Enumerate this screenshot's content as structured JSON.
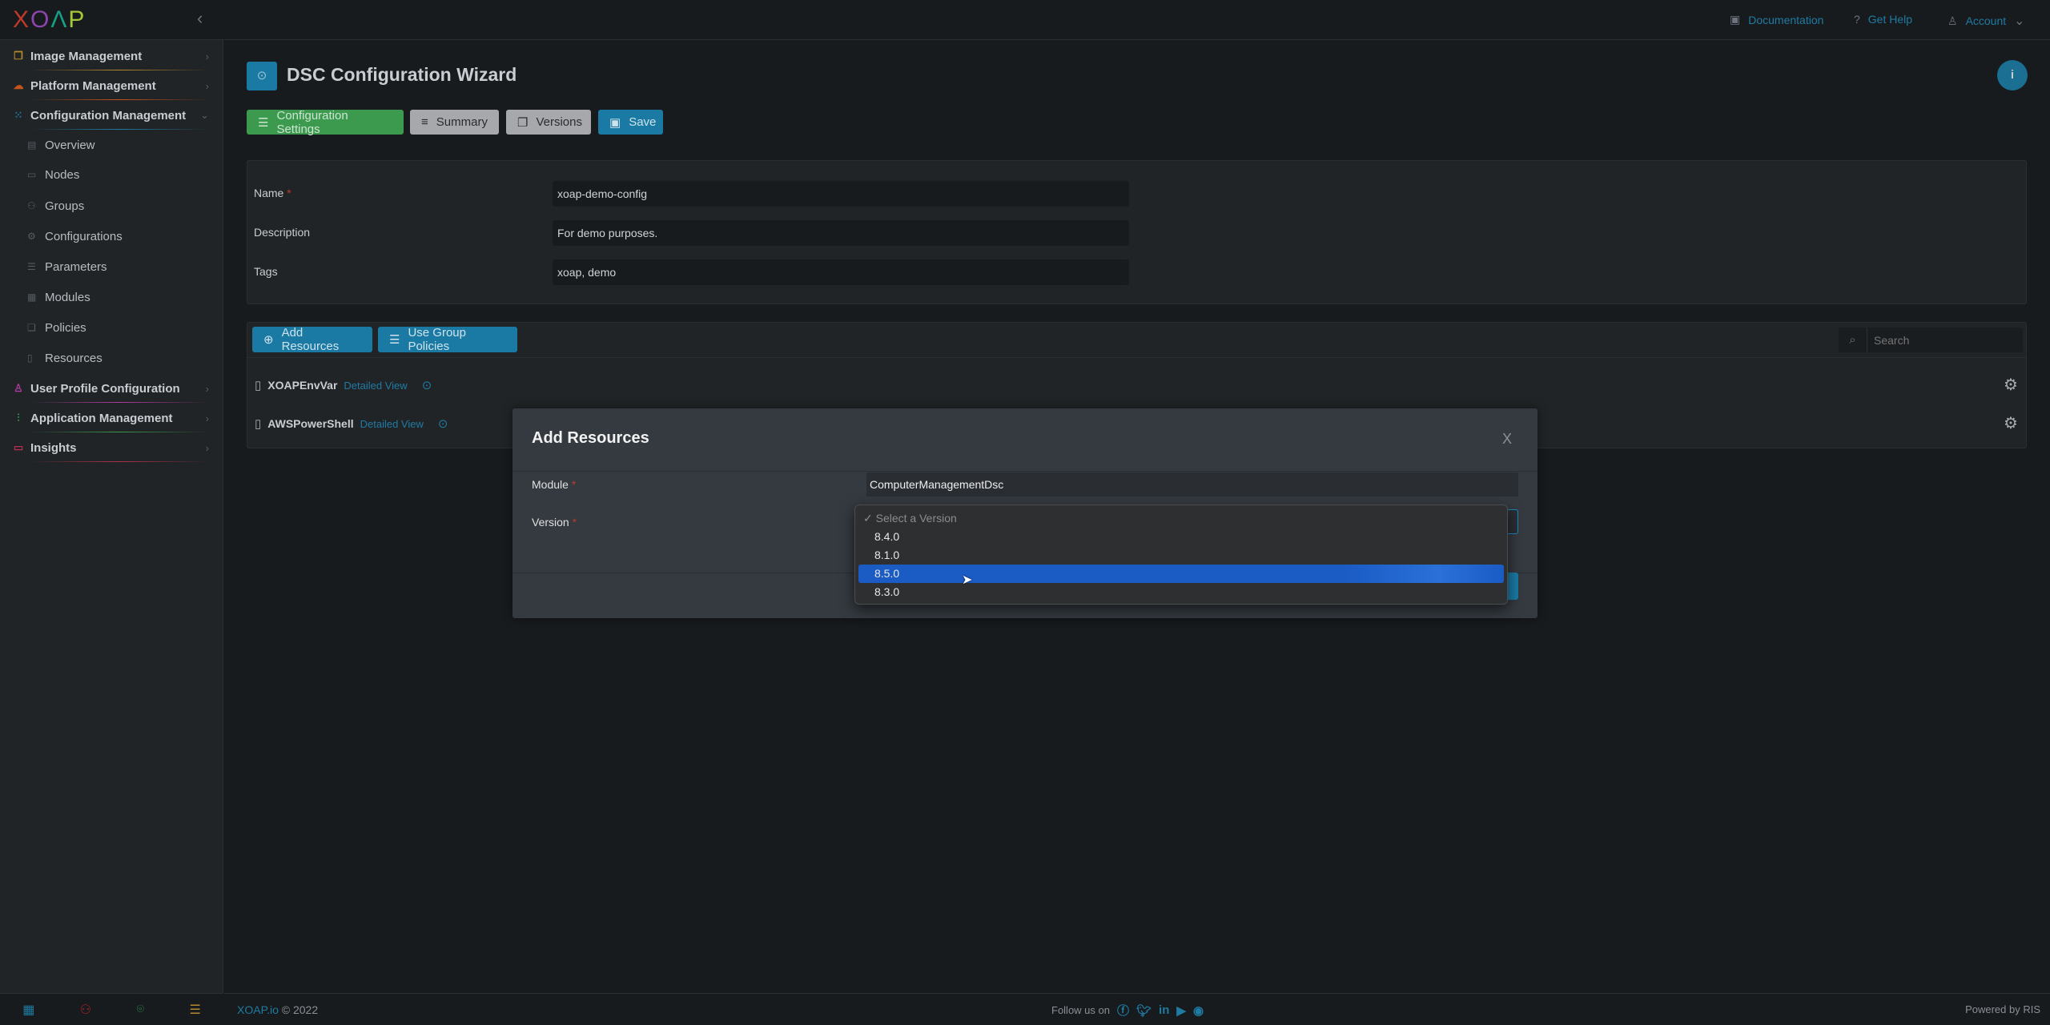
{
  "brand": {
    "logo": "XOAP",
    "accent": "#1a7aa3"
  },
  "sidebar": {
    "items": [
      {
        "label": "Image Management",
        "icon": "images-icon",
        "color": "#b58a2c"
      },
      {
        "label": "Platform Management",
        "icon": "cloud-icon",
        "color": "#c4541c"
      },
      {
        "label": "Configuration Management",
        "icon": "grid-icon",
        "color": "#1f7ba3"
      },
      {
        "label": "User Profile Configuration",
        "icon": "user-icon",
        "color": "#b03aa0"
      },
      {
        "label": "Application Management",
        "icon": "sitemap-icon",
        "color": "#3d9a4e"
      },
      {
        "label": "Insights",
        "icon": "monitor-icon",
        "color": "#b0304a"
      }
    ],
    "subitems": [
      "Overview",
      "Nodes",
      "Groups",
      "Configurations",
      "Parameters",
      "Modules",
      "Policies",
      "Resources"
    ]
  },
  "topbar": {
    "documentation": "Documentation",
    "help": "Get Help",
    "account": "Account"
  },
  "page": {
    "title": "DSC Configuration Wizard",
    "tabs": {
      "settings": "Configuration Settings",
      "summary": "Summary",
      "versions": "Versions",
      "save": "Save"
    }
  },
  "form": {
    "name_label": "Name",
    "name_value": "xoap-demo-config",
    "description_label": "Description",
    "description_value": "For demo purposes.",
    "tags_label": "Tags",
    "tags_value": "xoap, demo",
    "required": "*"
  },
  "resources": {
    "add": "Add Resources",
    "group": "Use Group Policies",
    "search_placeholder": "Search",
    "rows": [
      {
        "name": "XOAPEnvVar",
        "link": "Detailed View"
      },
      {
        "name": "AWSPowerShell",
        "link": "Detailed View"
      }
    ]
  },
  "modal": {
    "title": "Add Resources",
    "close": "X",
    "module_label": "Module",
    "module_value": "ComputerManagementDsc",
    "version_label": "Version",
    "dropdown": {
      "placeholder": "✓ Select a Version",
      "options": [
        "8.4.0",
        "8.1.0",
        "8.5.0",
        "8.3.0"
      ],
      "highlighted": "8.5.0"
    }
  },
  "footer": {
    "brand": "XOAP.io",
    "copyright": "© 2022",
    "follow": "Follow us on",
    "powered": "Powered by RIS"
  }
}
